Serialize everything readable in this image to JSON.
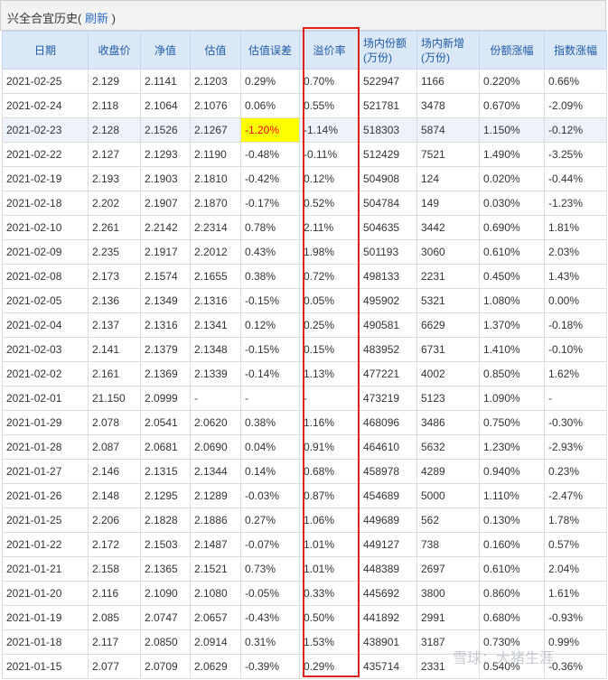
{
  "header": {
    "title": "兴全合宜历史",
    "paren_open": "(",
    "refresh": "刷新",
    "paren_close": ")"
  },
  "table": {
    "columns": [
      "日期",
      "收盘价",
      "净值",
      "估值",
      "估值误差",
      "溢价率",
      "场内份额\n(万份)",
      "场内新增\n(万份)",
      "份额涨幅",
      "指数涨幅"
    ],
    "rows": [
      [
        "2021-02-25",
        "2.129",
        "2.1141",
        "2.1203",
        "0.29%",
        "0.70%",
        "522947",
        "1166",
        "0.220%",
        "0.66%"
      ],
      [
        "2021-02-24",
        "2.118",
        "2.1064",
        "2.1076",
        "0.06%",
        "0.55%",
        "521781",
        "3478",
        "0.670%",
        "-2.09%"
      ],
      [
        "2021-02-23",
        "2.128",
        "2.1526",
        "2.1267",
        "-1.20%",
        "-1.14%",
        "518303",
        "5874",
        "1.150%",
        "-0.12%"
      ],
      [
        "2021-02-22",
        "2.127",
        "2.1293",
        "2.1190",
        "-0.48%",
        "-0.11%",
        "512429",
        "7521",
        "1.490%",
        "-3.25%"
      ],
      [
        "2021-02-19",
        "2.193",
        "2.1903",
        "2.1810",
        "-0.42%",
        "0.12%",
        "504908",
        "124",
        "0.020%",
        "-0.44%"
      ],
      [
        "2021-02-18",
        "2.202",
        "2.1907",
        "2.1870",
        "-0.17%",
        "0.52%",
        "504784",
        "149",
        "0.030%",
        "-1.23%"
      ],
      [
        "2021-02-10",
        "2.261",
        "2.2142",
        "2.2314",
        "0.78%",
        "2.11%",
        "504635",
        "3442",
        "0.690%",
        "1.81%"
      ],
      [
        "2021-02-09",
        "2.235",
        "2.1917",
        "2.2012",
        "0.43%",
        "1.98%",
        "501193",
        "3060",
        "0.610%",
        "2.03%"
      ],
      [
        "2021-02-08",
        "2.173",
        "2.1574",
        "2.1655",
        "0.38%",
        "0.72%",
        "498133",
        "2231",
        "0.450%",
        "1.43%"
      ],
      [
        "2021-02-05",
        "2.136",
        "2.1349",
        "2.1316",
        "-0.15%",
        "0.05%",
        "495902",
        "5321",
        "1.080%",
        "0.00%"
      ],
      [
        "2021-02-04",
        "2.137",
        "2.1316",
        "2.1341",
        "0.12%",
        "0.25%",
        "490581",
        "6629",
        "1.370%",
        "-0.18%"
      ],
      [
        "2021-02-03",
        "2.141",
        "2.1379",
        "2.1348",
        "-0.15%",
        "0.15%",
        "483952",
        "6731",
        "1.410%",
        "-0.10%"
      ],
      [
        "2021-02-02",
        "2.161",
        "2.1369",
        "2.1339",
        "-0.14%",
        "1.13%",
        "477221",
        "4002",
        "0.850%",
        "1.62%"
      ],
      [
        "2021-02-01",
        "21.150",
        "2.0999",
        "-",
        "-",
        "-",
        "473219",
        "5123",
        "1.090%",
        "-"
      ],
      [
        "2021-01-29",
        "2.078",
        "2.0541",
        "2.0620",
        "0.38%",
        "1.16%",
        "468096",
        "3486",
        "0.750%",
        "-0.30%"
      ],
      [
        "2021-01-28",
        "2.087",
        "2.0681",
        "2.0690",
        "0.04%",
        "0.91%",
        "464610",
        "5632",
        "1.230%",
        "-2.93%"
      ],
      [
        "2021-01-27",
        "2.146",
        "2.1315",
        "2.1344",
        "0.14%",
        "0.68%",
        "458978",
        "4289",
        "0.940%",
        "0.23%"
      ],
      [
        "2021-01-26",
        "2.148",
        "2.1295",
        "2.1289",
        "-0.03%",
        "0.87%",
        "454689",
        "5000",
        "1.110%",
        "-2.47%"
      ],
      [
        "2021-01-25",
        "2.206",
        "2.1828",
        "2.1886",
        "0.27%",
        "1.06%",
        "449689",
        "562",
        "0.130%",
        "1.78%"
      ],
      [
        "2021-01-22",
        "2.172",
        "2.1503",
        "2.1487",
        "-0.07%",
        "1.01%",
        "449127",
        "738",
        "0.160%",
        "0.57%"
      ],
      [
        "2021-01-21",
        "2.158",
        "2.1365",
        "2.1521",
        "0.73%",
        "1.01%",
        "448389",
        "2697",
        "0.610%",
        "2.04%"
      ],
      [
        "2021-01-20",
        "2.116",
        "2.1090",
        "2.1080",
        "-0.05%",
        "0.33%",
        "445692",
        "3800",
        "0.860%",
        "1.61%"
      ],
      [
        "2021-01-19",
        "2.085",
        "2.0747",
        "2.0657",
        "-0.43%",
        "0.50%",
        "441892",
        "2991",
        "0.680%",
        "-0.93%"
      ],
      [
        "2021-01-18",
        "2.117",
        "2.0850",
        "2.0914",
        "0.31%",
        "1.53%",
        "438901",
        "3187",
        "0.730%",
        "0.99%"
      ],
      [
        "2021-01-15",
        "2.077",
        "2.0709",
        "2.0629",
        "-0.39%",
        "0.29%",
        "435714",
        "2331",
        "0.540%",
        "-0.36%"
      ]
    ]
  },
  "watermark": "雪球：大猪生涯",
  "colors": {
    "header_bg": "#dbe8f7",
    "header_text": "#1f5aa6",
    "highlight_row": "#eef3fb",
    "error_highlight": "#ffff00",
    "redbox": "#e0201b",
    "link": "#2a6bc4"
  }
}
